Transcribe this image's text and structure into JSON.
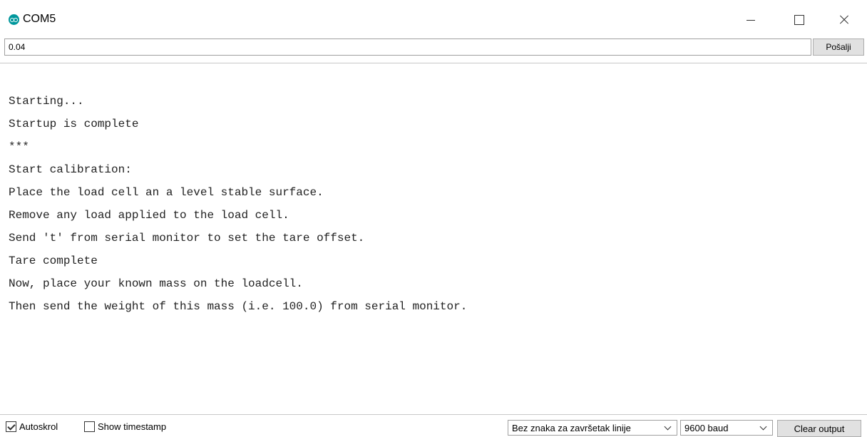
{
  "window": {
    "title": "COM5"
  },
  "send": {
    "input_value": "0.04",
    "button_label": "Pošalji"
  },
  "output": {
    "lines": [
      "Starting...",
      "Startup is complete",
      "***",
      "Start calibration:",
      "Place the load cell an a level stable surface.",
      "Remove any load applied to the load cell.",
      "Send 't' from serial monitor to set the tare offset.",
      "Tare complete",
      "Now, place your known mass on the loadcell.",
      "Then send the weight of this mass (i.e. 100.0) from serial monitor."
    ]
  },
  "bottom": {
    "autoscroll": {
      "label": "Autoskrol",
      "checked": true
    },
    "timestamp": {
      "label": "Show timestamp",
      "checked": false
    },
    "line_ending": "Bez znaka za završetak linije",
    "baud": "9600 baud",
    "clear_label": "Clear output"
  },
  "colors": {
    "app_icon": "#00979c"
  }
}
